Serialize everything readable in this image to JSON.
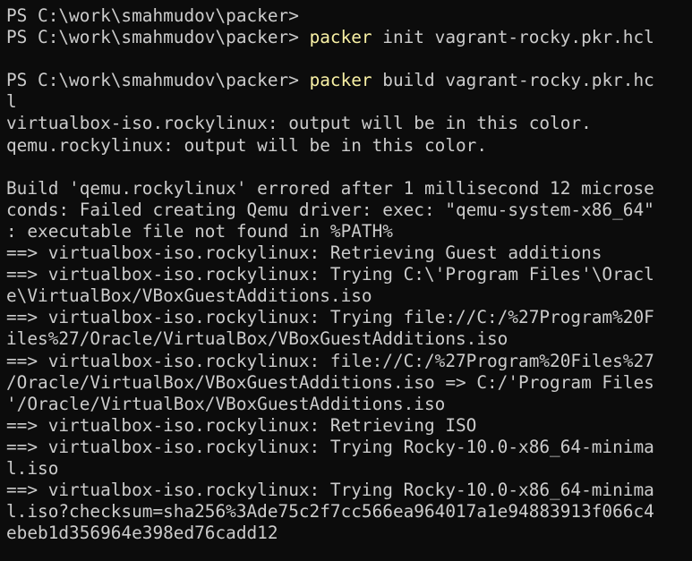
{
  "colors": {
    "background": "#0c0c0c",
    "text": "#cccccc",
    "command_highlight": "#f9f1a5"
  },
  "lines": [
    {
      "prompt": "PS C:\\work\\smahmudov\\packer>",
      "cmd": "",
      "rest": ""
    },
    {
      "prompt": "PS C:\\work\\smahmudov\\packer> ",
      "cmd": "packer",
      "rest": " init vagrant-rocky.pkr.hcl"
    },
    {
      "prompt": "",
      "cmd": "",
      "rest": ""
    },
    {
      "prompt": "PS C:\\work\\smahmudov\\packer> ",
      "cmd": "packer",
      "rest": " build vagrant-rocky.pkr.hc"
    },
    {
      "prompt": "",
      "cmd": "",
      "rest": "l"
    },
    {
      "prompt": "",
      "cmd": "",
      "rest": "virtualbox-iso.rockylinux: output will be in this color."
    },
    {
      "prompt": "",
      "cmd": "",
      "rest": "qemu.rockylinux: output will be in this color."
    },
    {
      "prompt": "",
      "cmd": "",
      "rest": ""
    },
    {
      "prompt": "",
      "cmd": "",
      "rest": "Build 'qemu.rockylinux' errored after 1 millisecond 12 microse"
    },
    {
      "prompt": "",
      "cmd": "",
      "rest": "conds: Failed creating Qemu driver: exec: \"qemu-system-x86_64\""
    },
    {
      "prompt": "",
      "cmd": "",
      "rest": ": executable file not found in %PATH%"
    },
    {
      "prompt": "",
      "cmd": "",
      "rest": "==> virtualbox-iso.rockylinux: Retrieving Guest additions"
    },
    {
      "prompt": "",
      "cmd": "",
      "rest": "==> virtualbox-iso.rockylinux: Trying C:\\'Program Files'\\Oracl"
    },
    {
      "prompt": "",
      "cmd": "",
      "rest": "e\\VirtualBox/VBoxGuestAdditions.iso"
    },
    {
      "prompt": "",
      "cmd": "",
      "rest": "==> virtualbox-iso.rockylinux: Trying file://C:/%27Program%20F"
    },
    {
      "prompt": "",
      "cmd": "",
      "rest": "iles%27/Oracle/VirtualBox/VBoxGuestAdditions.iso"
    },
    {
      "prompt": "",
      "cmd": "",
      "rest": "==> virtualbox-iso.rockylinux: file://C:/%27Program%20Files%27"
    },
    {
      "prompt": "",
      "cmd": "",
      "rest": "/Oracle/VirtualBox/VBoxGuestAdditions.iso => C:/'Program Files"
    },
    {
      "prompt": "",
      "cmd": "",
      "rest": "'/Oracle/VirtualBox/VBoxGuestAdditions.iso"
    },
    {
      "prompt": "",
      "cmd": "",
      "rest": "==> virtualbox-iso.rockylinux: Retrieving ISO"
    },
    {
      "prompt": "",
      "cmd": "",
      "rest": "==> virtualbox-iso.rockylinux: Trying Rocky-10.0-x86_64-minima"
    },
    {
      "prompt": "",
      "cmd": "",
      "rest": "l.iso"
    },
    {
      "prompt": "",
      "cmd": "",
      "rest": "==> virtualbox-iso.rockylinux: Trying Rocky-10.0-x86_64-minima"
    },
    {
      "prompt": "",
      "cmd": "",
      "rest": "l.iso?checksum=sha256%3Ade75c2f7cc566ea964017a1e94883913f066c4"
    },
    {
      "prompt": "",
      "cmd": "",
      "rest": "ebeb1d356964e398ed76cadd12"
    }
  ]
}
